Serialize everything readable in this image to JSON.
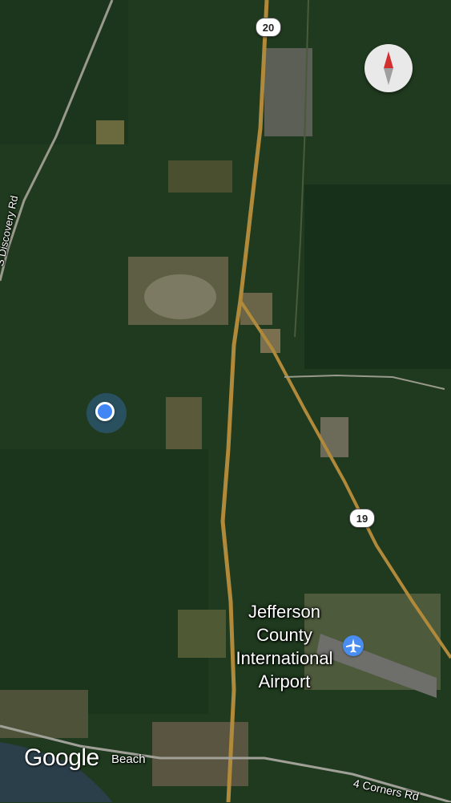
{
  "map": {
    "type": "satellite",
    "colors": {
      "forest": "#1f3a1e",
      "clearing": "#6b6a3e",
      "road": "#b08a3a",
      "water": "#2a3f4a",
      "location_blue": "#4285f4",
      "airport_blue": "#4a8df0"
    }
  },
  "routes": {
    "route_20": "20",
    "route_19": "19"
  },
  "roads": {
    "discovery": "S Discovery Rd",
    "four_corners": "4 Corners Rd"
  },
  "places": {
    "airport_line1": "Jefferson",
    "airport_line2": "County",
    "airport_line3": "International",
    "airport_line4": "Airport",
    "beach": "Beach"
  },
  "branding": {
    "logo": "Google"
  },
  "controls": {
    "compass_icon": "compass-icon"
  }
}
